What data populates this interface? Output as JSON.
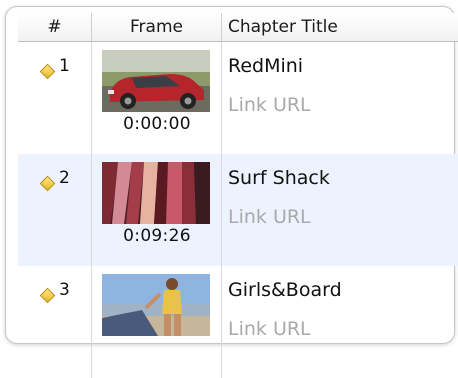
{
  "table": {
    "columns": [
      "#",
      "Frame",
      "Chapter Title"
    ],
    "rows": [
      {
        "num": "1",
        "time": "0:00:00",
        "title": "RedMini",
        "link": "Link URL",
        "thumbnail": "red mini car"
      },
      {
        "num": "2",
        "time": "0:09:26",
        "title": "Surf Shack",
        "link": "Link URL",
        "thumbnail": "surfboards"
      },
      {
        "num": "3",
        "time": "",
        "title": "Girls&Board",
        "link": "Link URL",
        "thumbnail": "girl on beach"
      }
    ]
  },
  "colors": {
    "alt_row": "#edf3fe",
    "marker": "#e8b51d",
    "placeholder": "#a9a9a9"
  }
}
